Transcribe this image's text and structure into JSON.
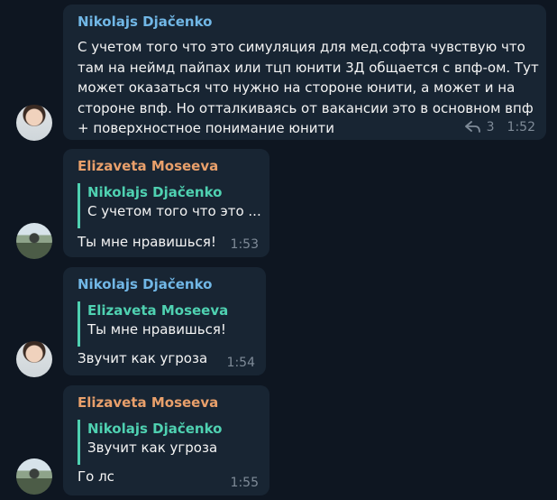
{
  "messages": [
    {
      "sender": "Nikolajs Djačenko",
      "text": "С учетом того что это симуляция для мед.софта чувствую что\nтам на неймд пайпах или тцп юнити 3Д общается с впф-ом. Тут\nможет оказаться что нужно на стороне юнити, а может и на\nстороне впф. Но отталкиваясь от вакансии это в основном впф\n+ поверхностное понимание юнити",
      "replies": "3",
      "time": "1:52"
    },
    {
      "sender": "Elizaveta Moseeva",
      "quote_sender": "Nikolajs Djačenko",
      "quote_text": "С учетом того что это ...",
      "text": "Ты мне нравишься!",
      "time": "1:53"
    },
    {
      "sender": "Nikolajs Djačenko",
      "quote_sender": "Elizaveta Moseeva",
      "quote_text": "Ты мне нравишься!",
      "text": "Звучит как угроза",
      "time": "1:54"
    },
    {
      "sender": "Elizaveta Moseeva",
      "quote_sender": "Nikolajs Djačenko",
      "quote_text": "Звучит как угроза",
      "text": "Го лс",
      "time": "1:55"
    }
  ],
  "icons": {
    "reply": "reply-arrow-icon"
  }
}
